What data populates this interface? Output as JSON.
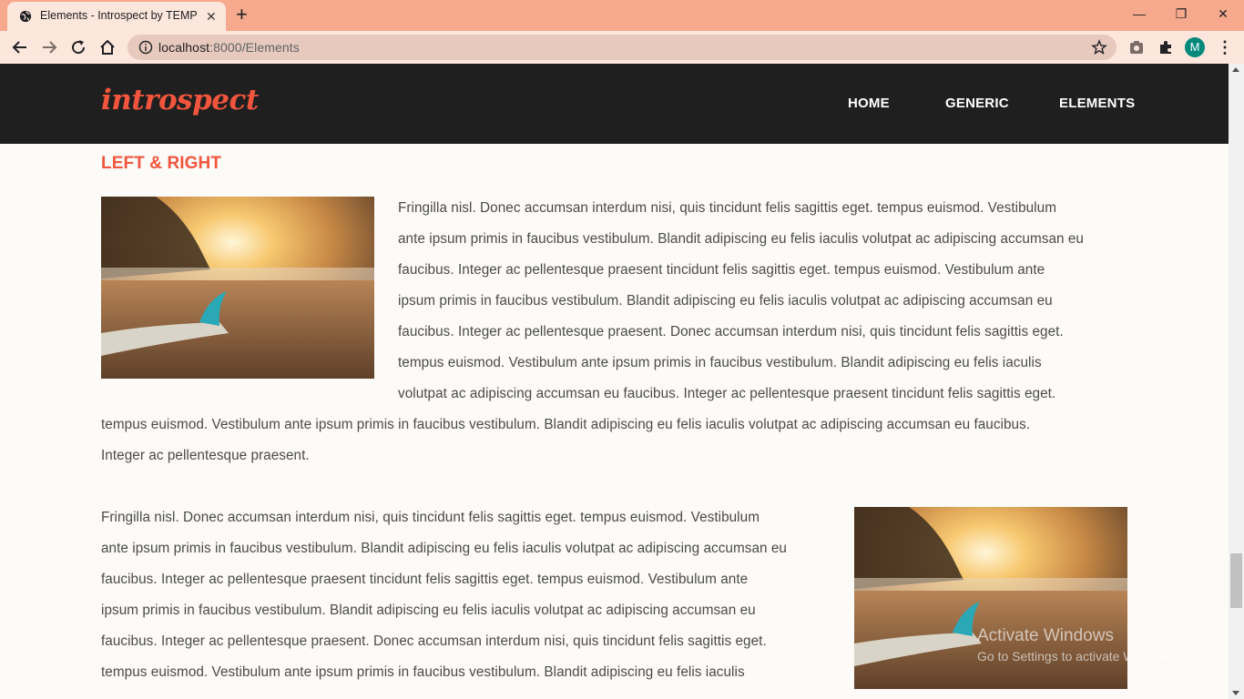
{
  "browser": {
    "tab_title": "Elements - Introspect by TEMPLA",
    "tab_close": "✕",
    "new_tab": "+",
    "url_host": "localhost",
    "url_rest": ":8000/Elements",
    "profile_initial": "M",
    "window_controls": {
      "minimize": "—",
      "restore": "❐",
      "close": "✕"
    },
    "accent_tab_bar": "#f6a98c",
    "accent_toolbar": "#fde6dc"
  },
  "site": {
    "logo": "introspect",
    "nav": [
      "HOME",
      "GENERIC",
      "ELEMENTS"
    ],
    "brand_color": "#f2553d",
    "header_color": "#1f1f1f"
  },
  "section": {
    "title": "LEFT & RIGHT"
  },
  "para1": {
    "lines": [
      "Fringilla nisl. Donec accumsan interdum nisi, quis tincidunt felis sagittis eget. tempus euismod. Vestibulum",
      "ante ipsum primis in faucibus vestibulum. Blandit adipiscing eu felis iaculis volutpat ac adipiscing accumsan eu",
      "faucibus. Integer ac pellentesque praesent tincidunt felis sagittis eget. tempus euismod. Vestibulum ante",
      "ipsum primis in faucibus vestibulum. Blandit adipiscing eu felis iaculis volutpat ac adipiscing accumsan eu",
      "faucibus. Integer ac pellentesque praesent. Donec accumsan interdum nisi, quis tincidunt felis sagittis eget.",
      "tempus euismod. Vestibulum ante ipsum primis in faucibus vestibulum. Blandit adipiscing eu felis iaculis",
      "volutpat ac adipiscing accumsan eu faucibus. Integer ac pellentesque praesent tincidunt felis sagittis eget.",
      "tempus euismod. Vestibulum ante ipsum primis in faucibus vestibulum. Blandit adipiscing eu felis iaculis volutpat ac adipiscing accumsan eu faucibus.",
      "Integer ac pellentesque praesent."
    ]
  },
  "para2": {
    "lines": [
      "Fringilla nisl. Donec accumsan interdum nisi, quis tincidunt felis sagittis eget. tempus euismod. Vestibulum",
      "ante ipsum primis in faucibus vestibulum. Blandit adipiscing eu felis iaculis volutpat ac adipiscing accumsan eu",
      "faucibus. Integer ac pellentesque praesent tincidunt felis sagittis eget. tempus euismod. Vestibulum ante",
      "ipsum primis in faucibus vestibulum. Blandit adipiscing eu felis iaculis volutpat ac adipiscing accumsan eu",
      "faucibus. Integer ac pellentesque praesent. Donec accumsan interdum nisi, quis tincidunt felis sagittis eget.",
      "tempus euismod. Vestibulum ante ipsum primis in faucibus vestibulum. Blandit adipiscing eu felis iaculis"
    ]
  },
  "watermark": {
    "title": "Activate Windows",
    "subtitle": "Go to Settings to activate Windows."
  }
}
